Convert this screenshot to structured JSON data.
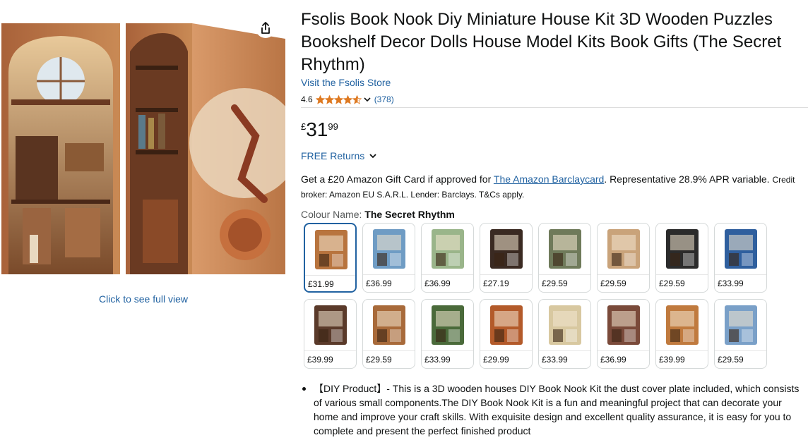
{
  "product": {
    "title": "Fsolis Book Nook Diy Miniature House Kit 3D Wooden Puzzles Bookshelf Decor Dolls House Model Kits Book Gifts (The Secret Rhythm)",
    "store_link": "Visit the Fsolis Store",
    "rating": "4.6",
    "stars_fraction": 0.92,
    "review_count": "(378)",
    "price_symbol": "£",
    "price_whole": "31",
    "price_fraction": "99",
    "returns_label": "FREE Returns",
    "promo": {
      "text_before": "Get a £20 Amazon Gift Card if approved for ",
      "link": "The Amazon Barclaycard",
      "text_after": ". Representative 28.9% APR variable. ",
      "small": "Credit broker: Amazon EU S.A.R.L. Lender: Barclays. T&Cs apply."
    },
    "colour_label": "Colour Name:",
    "colour_value": "The Secret Rhythm",
    "full_view_link": "Click to see full view",
    "share_icon": "share-icon",
    "bullets": [
      "【DIY Product】- This is a 3D wooden houses DIY Book Nook Kit the dust cover plate included, which consists of various small components.The DIY Book Nook Kit is a fun and meaningful project that can decorate your home and improve your craft skills. With exquisite design and excellent quality assurance, it is easy for you to complete and present the perfect finished product"
    ]
  },
  "swatches": [
    {
      "price": "£31.99",
      "selected": true,
      "color": "#b8743e"
    },
    {
      "price": "£36.99",
      "selected": false,
      "color": "#6f9cc4"
    },
    {
      "price": "£36.99",
      "selected": false,
      "color": "#9ab58a"
    },
    {
      "price": "£27.19",
      "selected": false,
      "color": "#3a2a22"
    },
    {
      "price": "£29.59",
      "selected": false,
      "color": "#6f7a5a"
    },
    {
      "price": "£29.59",
      "selected": false,
      "color": "#c9a37a"
    },
    {
      "price": "£29.59",
      "selected": false,
      "color": "#2b2b2b"
    },
    {
      "price": "£33.99",
      "selected": false,
      "color": "#2f5f9e"
    },
    {
      "price": "£39.99",
      "selected": false,
      "color": "#5a3a2a"
    },
    {
      "price": "£29.59",
      "selected": false,
      "color": "#a86a3a"
    },
    {
      "price": "£33.99",
      "selected": false,
      "color": "#4a6a3a"
    },
    {
      "price": "£29.99",
      "selected": false,
      "color": "#b35a2a"
    },
    {
      "price": "£33.99",
      "selected": false,
      "color": "#d8c8a0"
    },
    {
      "price": "£36.99",
      "selected": false,
      "color": "#7a4a3a"
    },
    {
      "price": "£39.99",
      "selected": false,
      "color": "#c07a3e"
    },
    {
      "price": "£29.59",
      "selected": false,
      "color": "#7aa0c8"
    }
  ],
  "colors": {
    "link": "#2162A1",
    "text": "#0F1111",
    "star": "#DE7921",
    "selected_border": "#2162A1"
  }
}
